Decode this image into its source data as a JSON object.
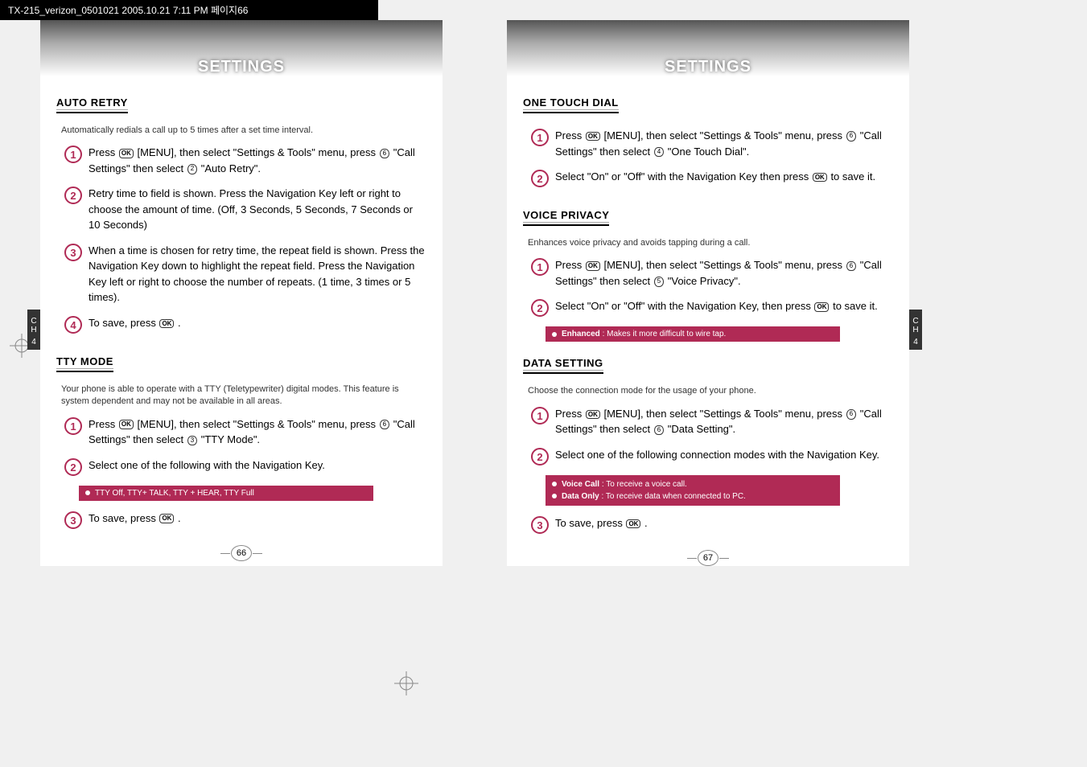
{
  "header_strip": "TX-215_verizon_0501021  2005.10.21  7:11 PM  페이지66",
  "left": {
    "banner": "SETTINGS",
    "tab": {
      "ch": "C\nH",
      "num": "4"
    },
    "pageNumber": "66",
    "sections": {
      "auto_retry": {
        "title": "AUTO RETRY",
        "intro": "Automatically redials a call up to 5 times after a set time interval.",
        "steps": {
          "1": {
            "pre": "Press ",
            "mid1": " [MENU], then select \"Settings & Tools\" menu, press ",
            "key": "6",
            "mid2": " \"Call Settings\" then select ",
            "key2": "2",
            "post": " \"Auto Retry\"."
          },
          "2": "Retry time to field is shown. Press the Navigation Key left or right to choose the amount of time. (Off, 3 Seconds, 5 Seconds, 7 Seconds or 10 Seconds)",
          "3": "When a time is chosen for retry time, the repeat field is shown. Press the Navigation Key down to highlight the repeat field. Press the Navigation Key left or right to choose the number of repeats. (1 time, 3 times or 5 times).",
          "4": {
            "pre": "To save, press ",
            "post": " ."
          }
        }
      },
      "tty_mode": {
        "title": "TTY MODE",
        "intro": "Your phone is able to operate with a TTY (Teletypewriter) digital modes. This feature is system dependent and may not be available in all areas.",
        "steps": {
          "1": {
            "pre": "Press ",
            "mid1": " [MENU], then select \"Settings & Tools\" menu, press ",
            "key": "6",
            "mid2": " \"Call Settings\" then select ",
            "key2": "3",
            "post": " \"TTY Mode\"."
          },
          "2": "Select one of the following with the Navigation Key.",
          "3": {
            "pre": "To save, press ",
            "post": " ."
          }
        },
        "info": "TTY Off, TTY+ TALK, TTY + HEAR, TTY Full"
      }
    }
  },
  "right": {
    "banner": "SETTINGS",
    "tab": {
      "ch": "C\nH",
      "num": "4"
    },
    "pageNumber": "67",
    "sections": {
      "one_touch": {
        "title": "ONE TOUCH DIAL",
        "steps": {
          "1": {
            "pre": "Press ",
            "mid1": " [MENU], then select \"Settings & Tools\" menu, press ",
            "key": "6",
            "mid2": " \"Call Settings\" then select ",
            "key2": "4",
            "post": " \"One Touch Dial\"."
          },
          "2": {
            "pre": "Select \"On\" or \"Off\" with the Navigation Key then press ",
            "post": " to save it."
          }
        }
      },
      "voice_privacy": {
        "title": "VOICE PRIVACY",
        "intro": "Enhances voice privacy and avoids tapping during a call.",
        "steps": {
          "1": {
            "pre": "Press ",
            "mid1": " [MENU], then select \"Settings & Tools\" menu, press ",
            "key": "6",
            "mid2": " \"Call Settings\" then select ",
            "key2": "5",
            "post": " \"Voice Privacy\"."
          },
          "2": {
            "pre": "Select \"On\" or \"Off\" with the Navigation Key, then press ",
            "post": " to save it."
          }
        },
        "info": {
          "bold": "Enhanced",
          "rest": " : Makes it more difficult to wire tap."
        }
      },
      "data_setting": {
        "title": "DATA SETTING",
        "intro": "Choose the connection mode for the usage of your phone.",
        "steps": {
          "1": {
            "pre": "Press ",
            "mid1": " [MENU], then select \"Settings & Tools\" menu, press ",
            "key": "6",
            "mid2": " \"Call Settings\" then select ",
            "key2": "6",
            "post": " \"Data Setting\"."
          },
          "2": "Select one of the following connection modes with the Navigation Key.",
          "3": {
            "pre": "To save, press ",
            "post": " ."
          }
        },
        "info": {
          "line1": {
            "bold": "Voice Call",
            "rest": " : To receive a voice call."
          },
          "line2": {
            "bold": "Data Only",
            "rest": " : To receive data when connected to PC."
          }
        }
      }
    }
  }
}
